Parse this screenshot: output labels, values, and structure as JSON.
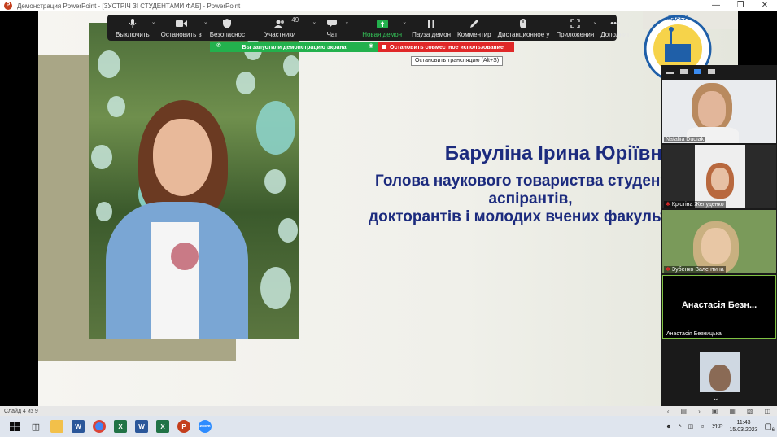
{
  "window": {
    "title": "Демонстрация PowerPoint - [ЗУСТРІЧ ЗІ СТУДЕНТАМИ ФАБ] - PowerPoint"
  },
  "zoom_toolbar": {
    "items": [
      {
        "label": "Выключить",
        "icon": "microphone-icon"
      },
      {
        "label": "Остановить в",
        "icon": "video-camera-icon"
      },
      {
        "label": "Безопаснос",
        "icon": "shield-icon"
      },
      {
        "label": "Участники",
        "icon": "participants-icon",
        "count": "49"
      },
      {
        "label": "Чат",
        "icon": "chat-icon"
      },
      {
        "label": "Новая демон",
        "icon": "share-screen-icon"
      },
      {
        "label": "Пауза демон",
        "icon": "pause-icon"
      },
      {
        "label": "Комментир",
        "icon": "pen-icon"
      },
      {
        "label": "Дистанционное у",
        "icon": "mouse-icon"
      },
      {
        "label": "Приложения",
        "icon": "apps-icon"
      },
      {
        "label": "Дополнит",
        "icon": "more-icon"
      }
    ]
  },
  "share_bar": {
    "status": "Вы запустили демонстрацию экрана",
    "stop": "Остановить совместное использование",
    "tooltip": "Остановить трансляцию (Alt+S)"
  },
  "slide": {
    "title": "Баруліна Ірина Юріївна –",
    "subtitle_lines": [
      "Голова наукового товариства студентів,",
      "аспірантів,",
      "докторантів і молодих вчених факультету"
    ],
    "logo_text": "ХДАЕУ"
  },
  "video_panel": {
    "tiles": [
      {
        "name": "Nataliia Dudiak",
        "muted": false
      },
      {
        "name": "Крістіна Желуденко",
        "muted": true
      },
      {
        "name": "Зубенко Валентина",
        "muted": true
      },
      {
        "name": "Анастасія Безницька",
        "display": "Анастасія Безн...",
        "muted": false
      },
      {
        "name": "",
        "muted": false
      }
    ]
  },
  "status_bar": {
    "slide_info": "Слайд 4 из 9"
  },
  "taskbar": {
    "language": "УКР",
    "time": "11:43",
    "date": "15.03.2023",
    "notifications": "6"
  }
}
